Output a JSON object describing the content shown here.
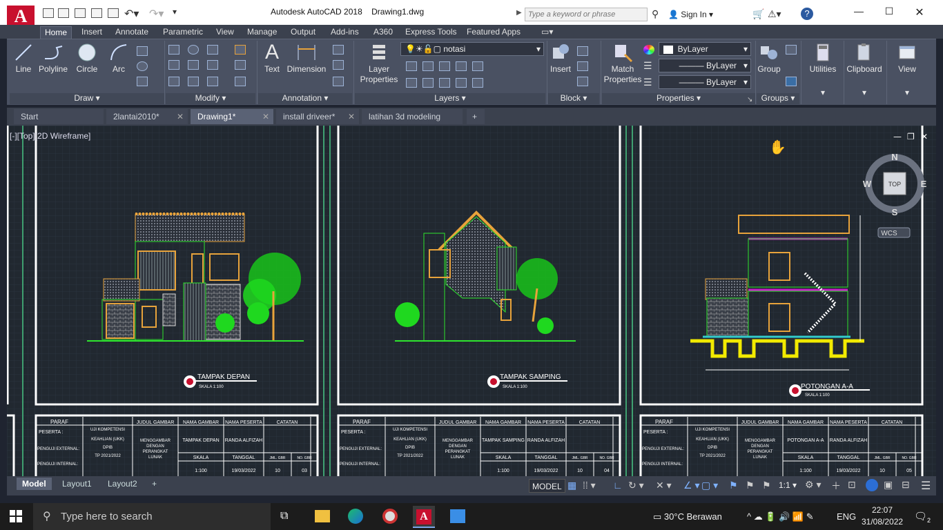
{
  "window": {
    "title": "Autodesk AutoCAD 2018",
    "filename": "Drawing1.dwg",
    "search_placeholder": "Type a keyword or phrase",
    "sign_in": "Sign In"
  },
  "ribbon_tabs": [
    "Home",
    "Insert",
    "Annotate",
    "Parametric",
    "View",
    "Manage",
    "Output",
    "Add-ins",
    "A360",
    "Express Tools",
    "Featured Apps"
  ],
  "ribbon": {
    "draw": {
      "line": "Line",
      "polyline": "Polyline",
      "circle": "Circle",
      "arc": "Arc",
      "panel": "Draw"
    },
    "modify": {
      "panel": "Modify"
    },
    "annotation": {
      "text": "Text",
      "dimension": "Dimension",
      "panel": "Annotation"
    },
    "layers": {
      "layer_properties": "Layer Properties",
      "layer_name": "notasi",
      "panel": "Layers"
    },
    "block": {
      "insert": "Insert",
      "panel": "Block"
    },
    "properties": {
      "match_line1": "Match",
      "match_line2": "Properties",
      "color": "ByLayer",
      "linetype": "ByLayer",
      "lineweight": "ByLayer",
      "panel": "Properties"
    },
    "groups": {
      "group": "Group",
      "panel": "Groups"
    },
    "utilities": "Utilities",
    "clipboard": "Clipboard",
    "view": "View"
  },
  "doc_tabs": [
    "Start",
    "2lantai2010*",
    "Drawing1*",
    "install driveer*",
    "latihan 3d modeling"
  ],
  "viewport_label": "[-][Top][2D Wireframe]",
  "viewcube": {
    "n": "N",
    "s": "S",
    "e": "E",
    "w": "W",
    "face": "TOP",
    "wcs": "WCS"
  },
  "sheets": [
    {
      "caption": "TAMPAK DEPAN",
      "scale_note": "SKALA 1:100",
      "nama_gambar": "TAMPAK DEPAN",
      "nama_peserta": "RANDA ALFIZAH",
      "skala": "1:100",
      "tanggal": "19/03/2022",
      "jml": "10",
      "no": "03"
    },
    {
      "caption": "TAMPAK SAMPING",
      "scale_note": "SKALA 1:100",
      "nama_gambar": "TAMPAK SAMPING",
      "nama_peserta": "RANDA ALFIZAH",
      "skala": "1:100",
      "tanggal": "19/03/2022",
      "jml": "10",
      "no": "04"
    },
    {
      "caption": "POTONGAN A-A",
      "scale_note": "SKALA 1:100",
      "nama_gambar": "POTONGAN A-A",
      "nama_peserta": "RANDA ALFIZAH",
      "skala": "1:100",
      "tanggal": "19/03/2022",
      "jml": "10",
      "no": "05"
    }
  ],
  "title_block": {
    "paraf": "PARAF",
    "peserta": "PESERTA :",
    "penguji_ext": "PENGUJI EXTERNAL:",
    "penguji_int": "PENGUJI INTERNAL:",
    "uji1": "UJI KOMPETENSI",
    "uji2": "KEAHLIAN (UKK)",
    "uji3": "DPIB",
    "uji4": "TP 2021/2022",
    "judul": "JUDUL GAMBAR",
    "judul_val1": "MENGGAMBAR",
    "judul_val2": "DENGAN",
    "judul_val3": "PERANGKAT",
    "judul_val4": "LUNAK",
    "nama_gambar": "NAMA GAMBAR",
    "nama_peserta": "NAMA PESERTA",
    "catatan": "CATATAN",
    "skala": "SKALA",
    "tanggal": "TANGGAL",
    "jml": "JML. GBR",
    "no": "NO. GBR"
  },
  "layout_tabs": [
    "Model",
    "Layout1",
    "Layout2"
  ],
  "status": {
    "model": "MODEL",
    "scale": "1:1"
  },
  "taskbar": {
    "search": "Type here to search",
    "weather": "30°C  Berawan",
    "lang": "ENG",
    "time": "22:07",
    "date": "31/08/2022",
    "notif": "2"
  }
}
